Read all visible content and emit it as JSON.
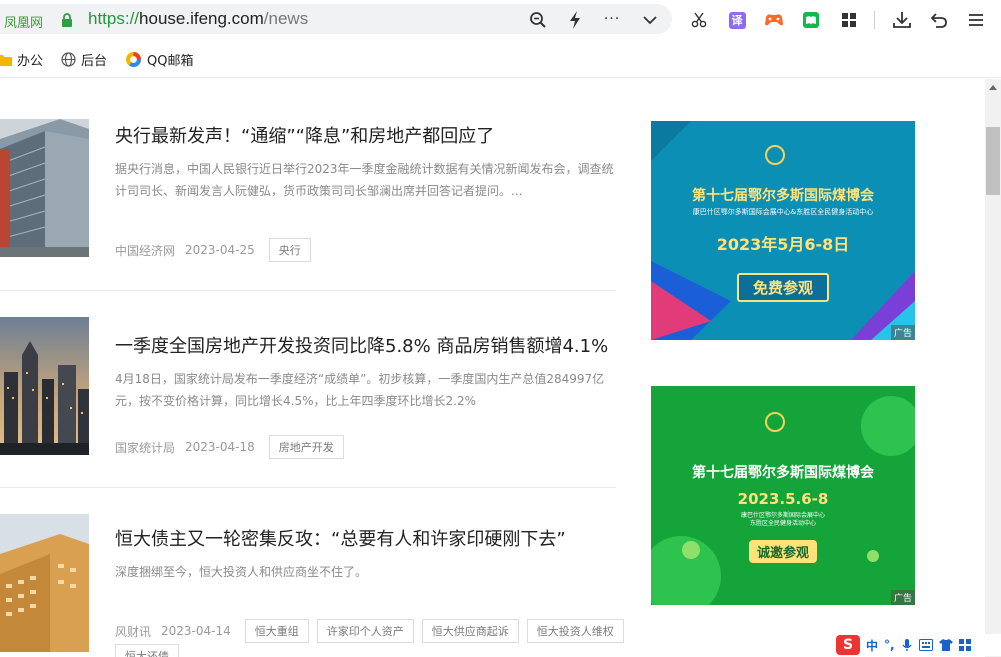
{
  "browser": {
    "site_name": "凤凰网",
    "url_proto": "https://",
    "url_host": "house.ifeng.com",
    "url_path": "/news",
    "badge_translate": "译"
  },
  "bookmarks": [
    {
      "label": "办公"
    },
    {
      "label": "后台"
    },
    {
      "label": "QQ邮箱"
    }
  ],
  "articles": [
    {
      "title": "央行最新发声！“通缩”“降息”和房地产都回应了",
      "desc": "据央行消息，中国人民银行近日举行2023年一季度金融统计数据有关情况新闻发布会，调查统计司司长、新闻发言人阮健弘，货币政策司司长邹澜出席并回答记者提问。...",
      "source": "中国经济网",
      "date": "2023-04-25",
      "tags": [
        "央行"
      ]
    },
    {
      "title": "一季度全国房地产开发投资同比降5.8% 商品房销售额增4.1%",
      "desc": "4月18日，国家统计局发布一季度经济“成绩单”。初步核算，一季度国内生产总值284997亿元，按不变价格计算，同比增长4.5%，比上年四季度环比增长2.2%",
      "source": "国家统计局",
      "date": "2023-04-18",
      "tags": [
        "房地产开发"
      ]
    },
    {
      "title": "恒大债主又一轮密集反攻：“总要有人和许家印硬刚下去”",
      "desc": "深度捆绑至今，恒大投资人和供应商坐不住了。",
      "source": "风财讯",
      "date": "2023-04-14",
      "tags": [
        "恒大重组",
        "许家印个人资产",
        "恒大供应商起诉",
        "恒大投资人维权",
        "恒大还债"
      ]
    }
  ],
  "ads": [
    {
      "title": "第十七届鄂尔多斯国际煤博会",
      "subtitle": "康巴什区鄂尔多斯国际会展中心&东胜区全民健身活动中心",
      "date": "2023年5月6-8日",
      "cta": "免费参观",
      "flag": "广告"
    },
    {
      "title": "第十七届鄂尔多斯国际煤博会",
      "subtitle": "康巴什区鄂尔多斯国际会展中心",
      "subtitle2": "东胜区全民健身活动中心",
      "date": "2023.5.6-8",
      "cta": "诚邀参观",
      "flag": "广告"
    }
  ],
  "ime": {
    "logo": "S",
    "lang": "中",
    "punct": "°,"
  },
  "colors": {
    "ad1_bg": "#0b8fb4",
    "ad2_bg": "#14a43a",
    "accent_green": "#1b9a3b"
  }
}
